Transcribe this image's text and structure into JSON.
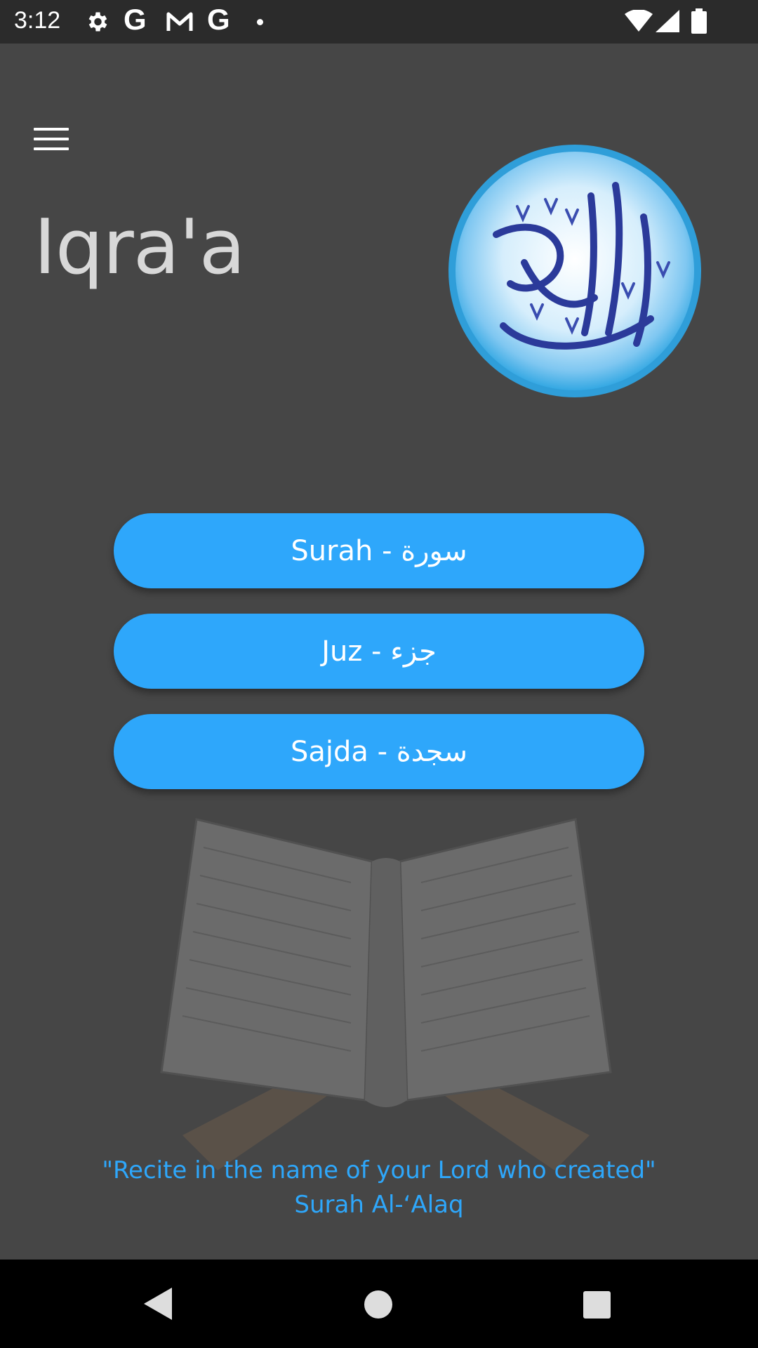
{
  "status_bar": {
    "time": "3:12",
    "icons": [
      "gear-icon",
      "google-g-icon",
      "gmail-icon",
      "google-g-icon",
      "notification-dot-icon",
      "wifi-icon",
      "signal-icon",
      "battery-icon"
    ],
    "g1": "G",
    "g2": "G"
  },
  "app": {
    "title": "Iqra'a",
    "menu_icon": "hamburger-menu-icon",
    "logo_icon": "quran-calligraphy-logo",
    "buttons": [
      {
        "label": "Surah - سورة"
      },
      {
        "label": "Juz - جزء"
      },
      {
        "label": "Sajda - سجدة"
      }
    ],
    "quote_line1": "\"Recite in the name of your Lord who created\"",
    "quote_line2": "Surah Al-‘Alaq",
    "accent_color": "#2ea7fb",
    "background_color": "#464646"
  },
  "nav_bar": {
    "icons": [
      "back-icon",
      "home-icon",
      "recents-icon"
    ]
  }
}
